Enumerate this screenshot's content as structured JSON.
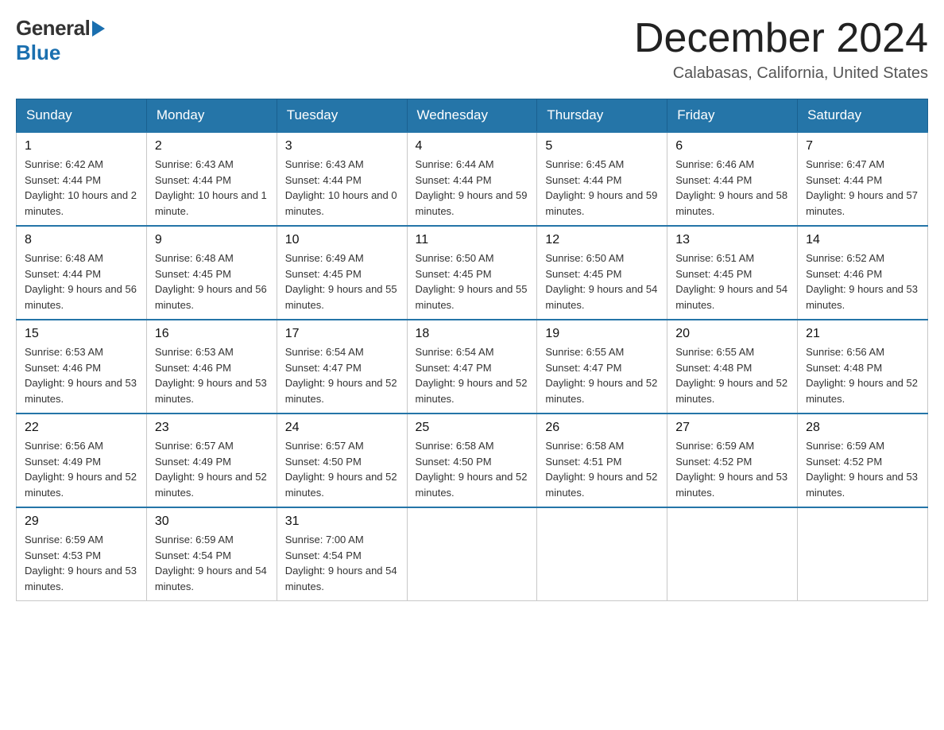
{
  "header": {
    "logo_general": "General",
    "logo_blue": "Blue",
    "month_title": "December 2024",
    "location": "Calabasas, California, United States"
  },
  "days_of_week": [
    "Sunday",
    "Monday",
    "Tuesday",
    "Wednesday",
    "Thursday",
    "Friday",
    "Saturday"
  ],
  "weeks": [
    [
      {
        "day": "1",
        "sunrise": "6:42 AM",
        "sunset": "4:44 PM",
        "daylight": "10 hours and 2 minutes."
      },
      {
        "day": "2",
        "sunrise": "6:43 AM",
        "sunset": "4:44 PM",
        "daylight": "10 hours and 1 minute."
      },
      {
        "day": "3",
        "sunrise": "6:43 AM",
        "sunset": "4:44 PM",
        "daylight": "10 hours and 0 minutes."
      },
      {
        "day": "4",
        "sunrise": "6:44 AM",
        "sunset": "4:44 PM",
        "daylight": "9 hours and 59 minutes."
      },
      {
        "day": "5",
        "sunrise": "6:45 AM",
        "sunset": "4:44 PM",
        "daylight": "9 hours and 59 minutes."
      },
      {
        "day": "6",
        "sunrise": "6:46 AM",
        "sunset": "4:44 PM",
        "daylight": "9 hours and 58 minutes."
      },
      {
        "day": "7",
        "sunrise": "6:47 AM",
        "sunset": "4:44 PM",
        "daylight": "9 hours and 57 minutes."
      }
    ],
    [
      {
        "day": "8",
        "sunrise": "6:48 AM",
        "sunset": "4:44 PM",
        "daylight": "9 hours and 56 minutes."
      },
      {
        "day": "9",
        "sunrise": "6:48 AM",
        "sunset": "4:45 PM",
        "daylight": "9 hours and 56 minutes."
      },
      {
        "day": "10",
        "sunrise": "6:49 AM",
        "sunset": "4:45 PM",
        "daylight": "9 hours and 55 minutes."
      },
      {
        "day": "11",
        "sunrise": "6:50 AM",
        "sunset": "4:45 PM",
        "daylight": "9 hours and 55 minutes."
      },
      {
        "day": "12",
        "sunrise": "6:50 AM",
        "sunset": "4:45 PM",
        "daylight": "9 hours and 54 minutes."
      },
      {
        "day": "13",
        "sunrise": "6:51 AM",
        "sunset": "4:45 PM",
        "daylight": "9 hours and 54 minutes."
      },
      {
        "day": "14",
        "sunrise": "6:52 AM",
        "sunset": "4:46 PM",
        "daylight": "9 hours and 53 minutes."
      }
    ],
    [
      {
        "day": "15",
        "sunrise": "6:53 AM",
        "sunset": "4:46 PM",
        "daylight": "9 hours and 53 minutes."
      },
      {
        "day": "16",
        "sunrise": "6:53 AM",
        "sunset": "4:46 PM",
        "daylight": "9 hours and 53 minutes."
      },
      {
        "day": "17",
        "sunrise": "6:54 AM",
        "sunset": "4:47 PM",
        "daylight": "9 hours and 52 minutes."
      },
      {
        "day": "18",
        "sunrise": "6:54 AM",
        "sunset": "4:47 PM",
        "daylight": "9 hours and 52 minutes."
      },
      {
        "day": "19",
        "sunrise": "6:55 AM",
        "sunset": "4:47 PM",
        "daylight": "9 hours and 52 minutes."
      },
      {
        "day": "20",
        "sunrise": "6:55 AM",
        "sunset": "4:48 PM",
        "daylight": "9 hours and 52 minutes."
      },
      {
        "day": "21",
        "sunrise": "6:56 AM",
        "sunset": "4:48 PM",
        "daylight": "9 hours and 52 minutes."
      }
    ],
    [
      {
        "day": "22",
        "sunrise": "6:56 AM",
        "sunset": "4:49 PM",
        "daylight": "9 hours and 52 minutes."
      },
      {
        "day": "23",
        "sunrise": "6:57 AM",
        "sunset": "4:49 PM",
        "daylight": "9 hours and 52 minutes."
      },
      {
        "day": "24",
        "sunrise": "6:57 AM",
        "sunset": "4:50 PM",
        "daylight": "9 hours and 52 minutes."
      },
      {
        "day": "25",
        "sunrise": "6:58 AM",
        "sunset": "4:50 PM",
        "daylight": "9 hours and 52 minutes."
      },
      {
        "day": "26",
        "sunrise": "6:58 AM",
        "sunset": "4:51 PM",
        "daylight": "9 hours and 52 minutes."
      },
      {
        "day": "27",
        "sunrise": "6:59 AM",
        "sunset": "4:52 PM",
        "daylight": "9 hours and 53 minutes."
      },
      {
        "day": "28",
        "sunrise": "6:59 AM",
        "sunset": "4:52 PM",
        "daylight": "9 hours and 53 minutes."
      }
    ],
    [
      {
        "day": "29",
        "sunrise": "6:59 AM",
        "sunset": "4:53 PM",
        "daylight": "9 hours and 53 minutes."
      },
      {
        "day": "30",
        "sunrise": "6:59 AM",
        "sunset": "4:54 PM",
        "daylight": "9 hours and 54 minutes."
      },
      {
        "day": "31",
        "sunrise": "7:00 AM",
        "sunset": "4:54 PM",
        "daylight": "9 hours and 54 minutes."
      },
      null,
      null,
      null,
      null
    ]
  ],
  "labels": {
    "sunrise": "Sunrise:",
    "sunset": "Sunset:",
    "daylight": "Daylight:"
  },
  "colors": {
    "header_bg": "#2575a8",
    "header_text": "#ffffff",
    "border_top_row": "#2575a8",
    "cell_border": "#c8c8c8"
  }
}
